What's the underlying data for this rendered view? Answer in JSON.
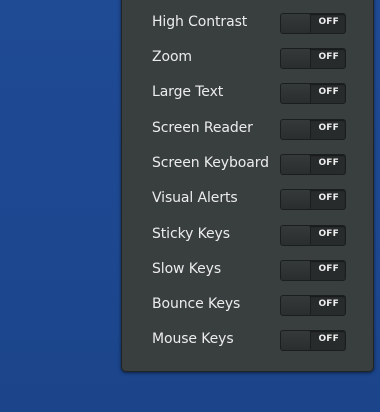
{
  "accessibility_menu": {
    "items": [
      {
        "label": "High Contrast",
        "state": "OFF"
      },
      {
        "label": "Zoom",
        "state": "OFF"
      },
      {
        "label": "Large Text",
        "state": "OFF"
      },
      {
        "label": "Screen Reader",
        "state": "OFF"
      },
      {
        "label": "Screen Keyboard",
        "state": "OFF"
      },
      {
        "label": "Visual Alerts",
        "state": "OFF"
      },
      {
        "label": "Sticky Keys",
        "state": "OFF"
      },
      {
        "label": "Slow Keys",
        "state": "OFF"
      },
      {
        "label": "Bounce Keys",
        "state": "OFF"
      },
      {
        "label": "Mouse Keys",
        "state": "OFF"
      }
    ]
  },
  "colors": {
    "desktop_background": "#1f4a92",
    "menu_background": "#393f3f",
    "switch_background": "#272b2b",
    "text": "#ececec"
  }
}
